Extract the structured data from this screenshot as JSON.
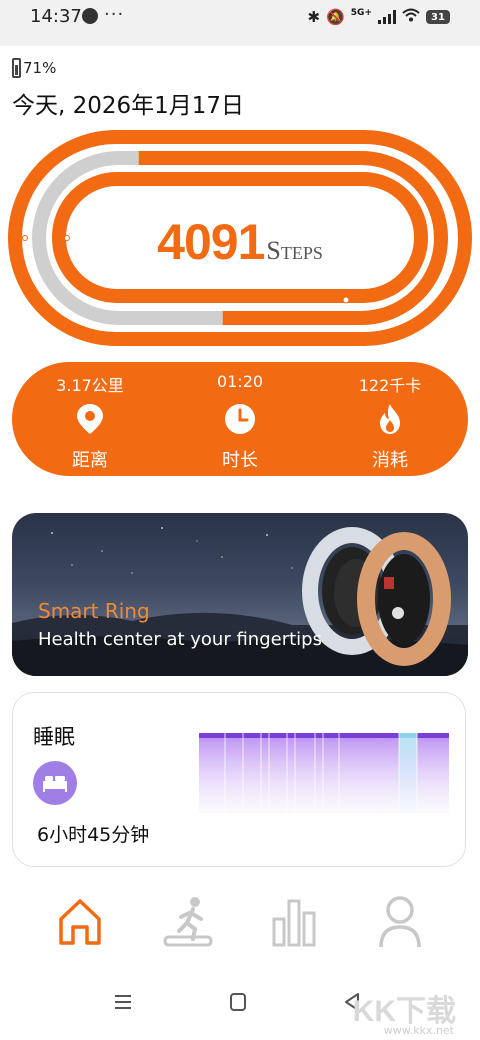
{
  "status_bar": {
    "time": "14:37",
    "dots": "···",
    "network": "5G+",
    "battery": "31"
  },
  "device": {
    "battery_pct": "71%",
    "date": "今天, 2026年1月17日"
  },
  "steps": {
    "count": "4091",
    "unit": "Steps",
    "progress": 0.62
  },
  "stats": [
    {
      "value": "3.17公里",
      "label": "距离",
      "icon": "location-pin-icon"
    },
    {
      "value": "01:20",
      "label": "时长",
      "icon": "clock-icon"
    },
    {
      "value": "122千卡",
      "label": "消耗",
      "icon": "flame-icon"
    }
  ],
  "banner": {
    "title": "Smart Ring",
    "subtitle": "Health center at your fingertips"
  },
  "sleep": {
    "title": "睡眠",
    "duration": "6小时45分钟",
    "icon": "bed-icon"
  },
  "nav": {
    "tabs": [
      {
        "name": "home-icon",
        "active": true
      },
      {
        "name": "exercise-icon",
        "active": false
      },
      {
        "name": "stats-icon",
        "active": false
      },
      {
        "name": "profile-icon",
        "active": false
      }
    ]
  },
  "watermark": {
    "text": "KK下载",
    "url": "www.kkx.net"
  },
  "colors": {
    "accent": "#f26a12",
    "track_grey": "#cfcfcf",
    "sleep_purple": "#9f7fe6"
  }
}
